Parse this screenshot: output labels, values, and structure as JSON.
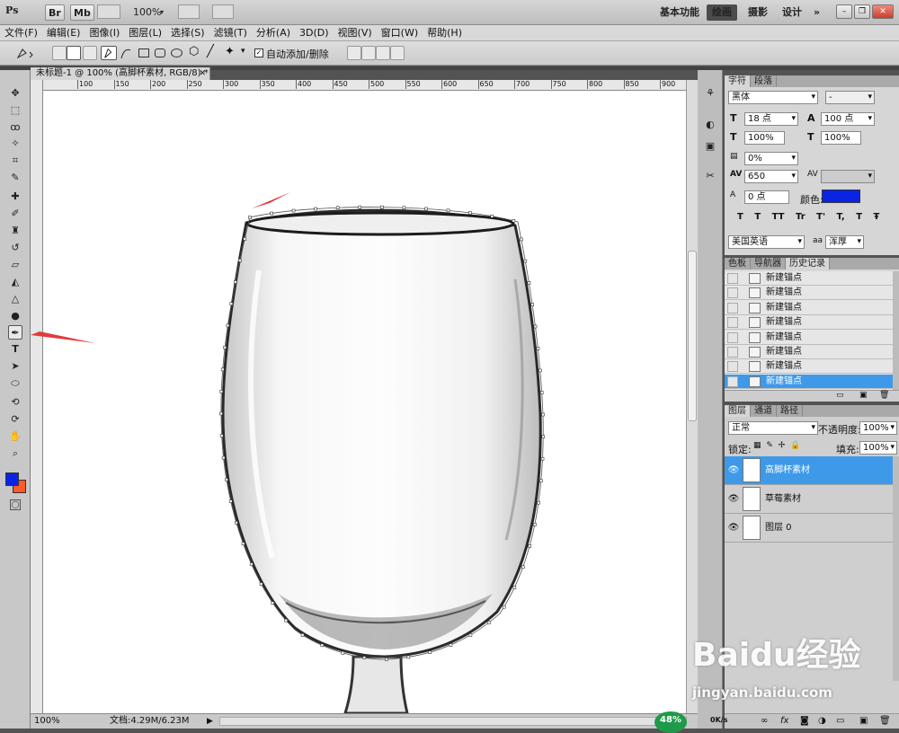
{
  "app": {
    "logo": "Ps",
    "bridge_btn": "Br",
    "minibridge_btn": "Mb",
    "zoom_select": "100%",
    "workspaces": [
      "基本功能",
      "绘画",
      "摄影",
      "设计"
    ],
    "active_workspace": "绘画",
    "more_label": "»"
  },
  "menu": [
    "文件(F)",
    "编辑(E)",
    "图像(I)",
    "图层(L)",
    "选择(S)",
    "滤镜(T)",
    "分析(A)",
    "3D(D)",
    "视图(V)",
    "窗口(W)",
    "帮助(H)"
  ],
  "options": {
    "auto_add_delete": "自动添加/删除",
    "auto_add_checked": true
  },
  "document": {
    "tab_title": "未标题-1 @ 100% (高脚杯素材, RGB/8) *",
    "ruler_labels": [
      "100",
      "150",
      "200",
      "250",
      "300",
      "350",
      "400",
      "450",
      "500",
      "550",
      "600",
      "650",
      "700",
      "750",
      "800",
      "850",
      "900"
    ],
    "status_zoom": "100%",
    "status_doc": "文档:4.29M/6.23M"
  },
  "character_panel": {
    "tabs": [
      "字符",
      "段落"
    ],
    "font_family": "黑体",
    "font_style": "-",
    "size": "18 点",
    "leading": "100 点",
    "vscale": "100%",
    "hscale": "100%",
    "baseline": "0%",
    "tracking": "650",
    "shift": "0 点",
    "color_label": "颜色:",
    "color": "#0a24e6",
    "style_buttons": [
      "T",
      "T",
      "TT",
      "Tr",
      "T'",
      "T,",
      "T",
      "Ŧ"
    ],
    "language": "美国英语",
    "aa_label": "aa",
    "aa_mode": "浑厚"
  },
  "history_panel": {
    "tabs": [
      "色板",
      "导航器",
      "历史记录"
    ],
    "items": [
      "新建锚点",
      "新建锚点",
      "新建锚点",
      "新建锚点",
      "新建锚点",
      "新建锚点",
      "新建锚点",
      "新建锚点"
    ],
    "selected_index": 7
  },
  "layers_panel": {
    "tabs": [
      "图层",
      "通道",
      "路径"
    ],
    "blend_mode": "正常",
    "opacity_label": "不透明度:",
    "opacity": "100%",
    "lock_label": "锁定:",
    "fill_label": "填充:",
    "fill": "100%",
    "layers": [
      {
        "name": "高脚杯素材",
        "selected": true
      },
      {
        "name": "草莓素材",
        "selected": false
      },
      {
        "name": "图层 0",
        "selected": false
      }
    ]
  },
  "tray": {
    "progress": "48%",
    "net_speed": "0K/s"
  },
  "watermark": {
    "brand": "Baidu经验",
    "url": "jingyan.baidu.com"
  },
  "colors": {
    "foreground": "#0a24e6",
    "background": "#ff5a2a",
    "selection_blue": "#3e9ae9",
    "annotation_arrow": "#e23b3b"
  }
}
